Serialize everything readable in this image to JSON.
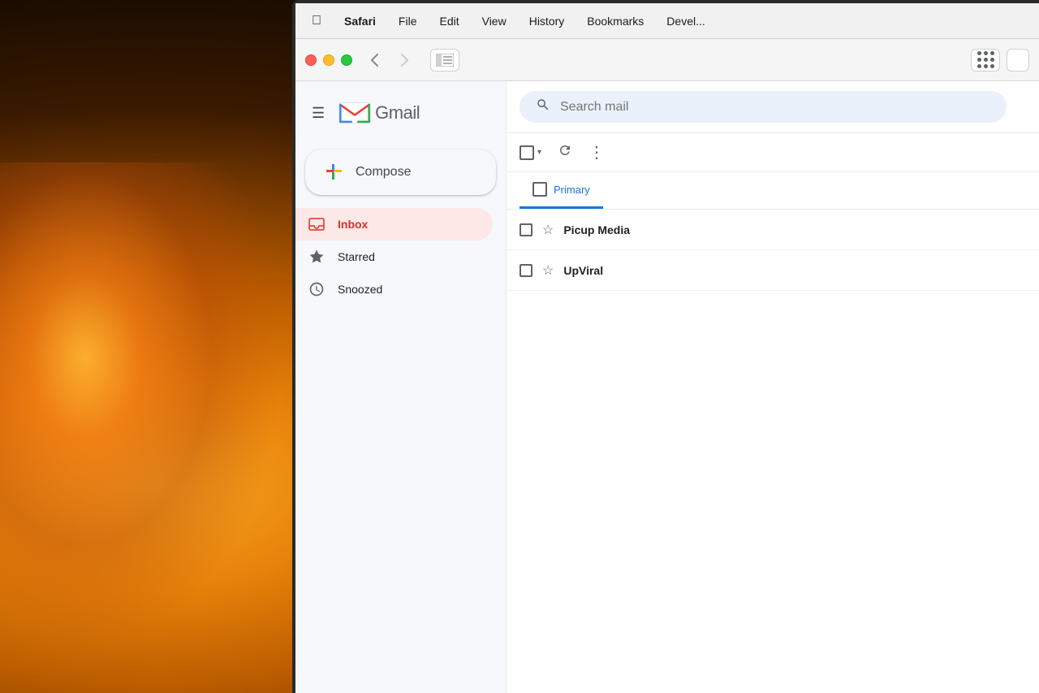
{
  "background": {
    "color": "#1a0a00"
  },
  "menubar": {
    "apple": "⌘",
    "items": [
      {
        "label": "Safari",
        "active": true
      },
      {
        "label": "File"
      },
      {
        "label": "Edit"
      },
      {
        "label": "View"
      },
      {
        "label": "History"
      },
      {
        "label": "Bookmarks"
      },
      {
        "label": "Devel..."
      }
    ]
  },
  "safari_toolbar": {
    "back_label": "‹",
    "forward_label": "›",
    "traffic_lights": [
      "red",
      "yellow",
      "green"
    ]
  },
  "gmail": {
    "logo_text": "Gmail",
    "search_placeholder": "Search mail",
    "compose_label": "Compose",
    "nav_items": [
      {
        "label": "Inbox",
        "active": true,
        "icon": "inbox"
      },
      {
        "label": "Starred",
        "active": false,
        "icon": "star"
      },
      {
        "label": "Snoozed",
        "active": false,
        "icon": "clock"
      }
    ],
    "tab": {
      "label": "Primary"
    },
    "email_rows": [
      {
        "sender": "Picup Media",
        "star": "☆"
      },
      {
        "sender": "UpViral",
        "star": "☆"
      }
    ]
  }
}
